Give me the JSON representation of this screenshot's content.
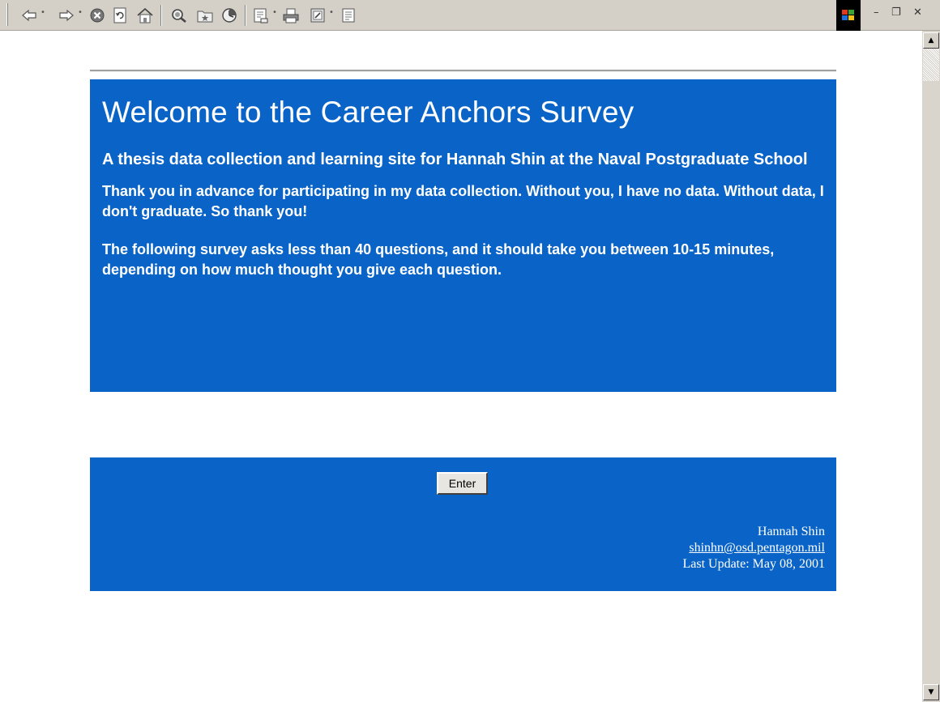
{
  "toolbar": {
    "items": [
      "back-icon",
      "forward-icon",
      "stop-icon",
      "refresh-icon",
      "home-icon",
      "search-icon",
      "favorites-icon",
      "history-icon",
      "mail-icon",
      "print-icon",
      "edit-icon",
      "discuss-icon"
    ],
    "window_controls": {
      "minimize": "–",
      "restore": "❐",
      "close": "✕"
    }
  },
  "page": {
    "title": "Welcome to the Career Anchors Survey",
    "subtitle": "A thesis data collection and learning site for Hannah Shin at the Naval Postgraduate School",
    "paragraph1": "Thank you in advance for participating in my data collection.  Without you, I have no data.  Without data, I don't graduate.  So thank you!",
    "paragraph2": "The following survey asks less than 40 questions, and it should take you between 10-15 minutes, depending on how much thought you give each question."
  },
  "enter_button": {
    "label": "Enter"
  },
  "footer": {
    "author": "Hannah Shin",
    "email": "shinhn@osd.pentagon.mil",
    "last_update": "Last Update: May 08, 2001"
  },
  "colors": {
    "panel_bg": "#0a64c8",
    "panel_text": "#ffffff",
    "toolbar_bg": "#d4d0c8"
  }
}
